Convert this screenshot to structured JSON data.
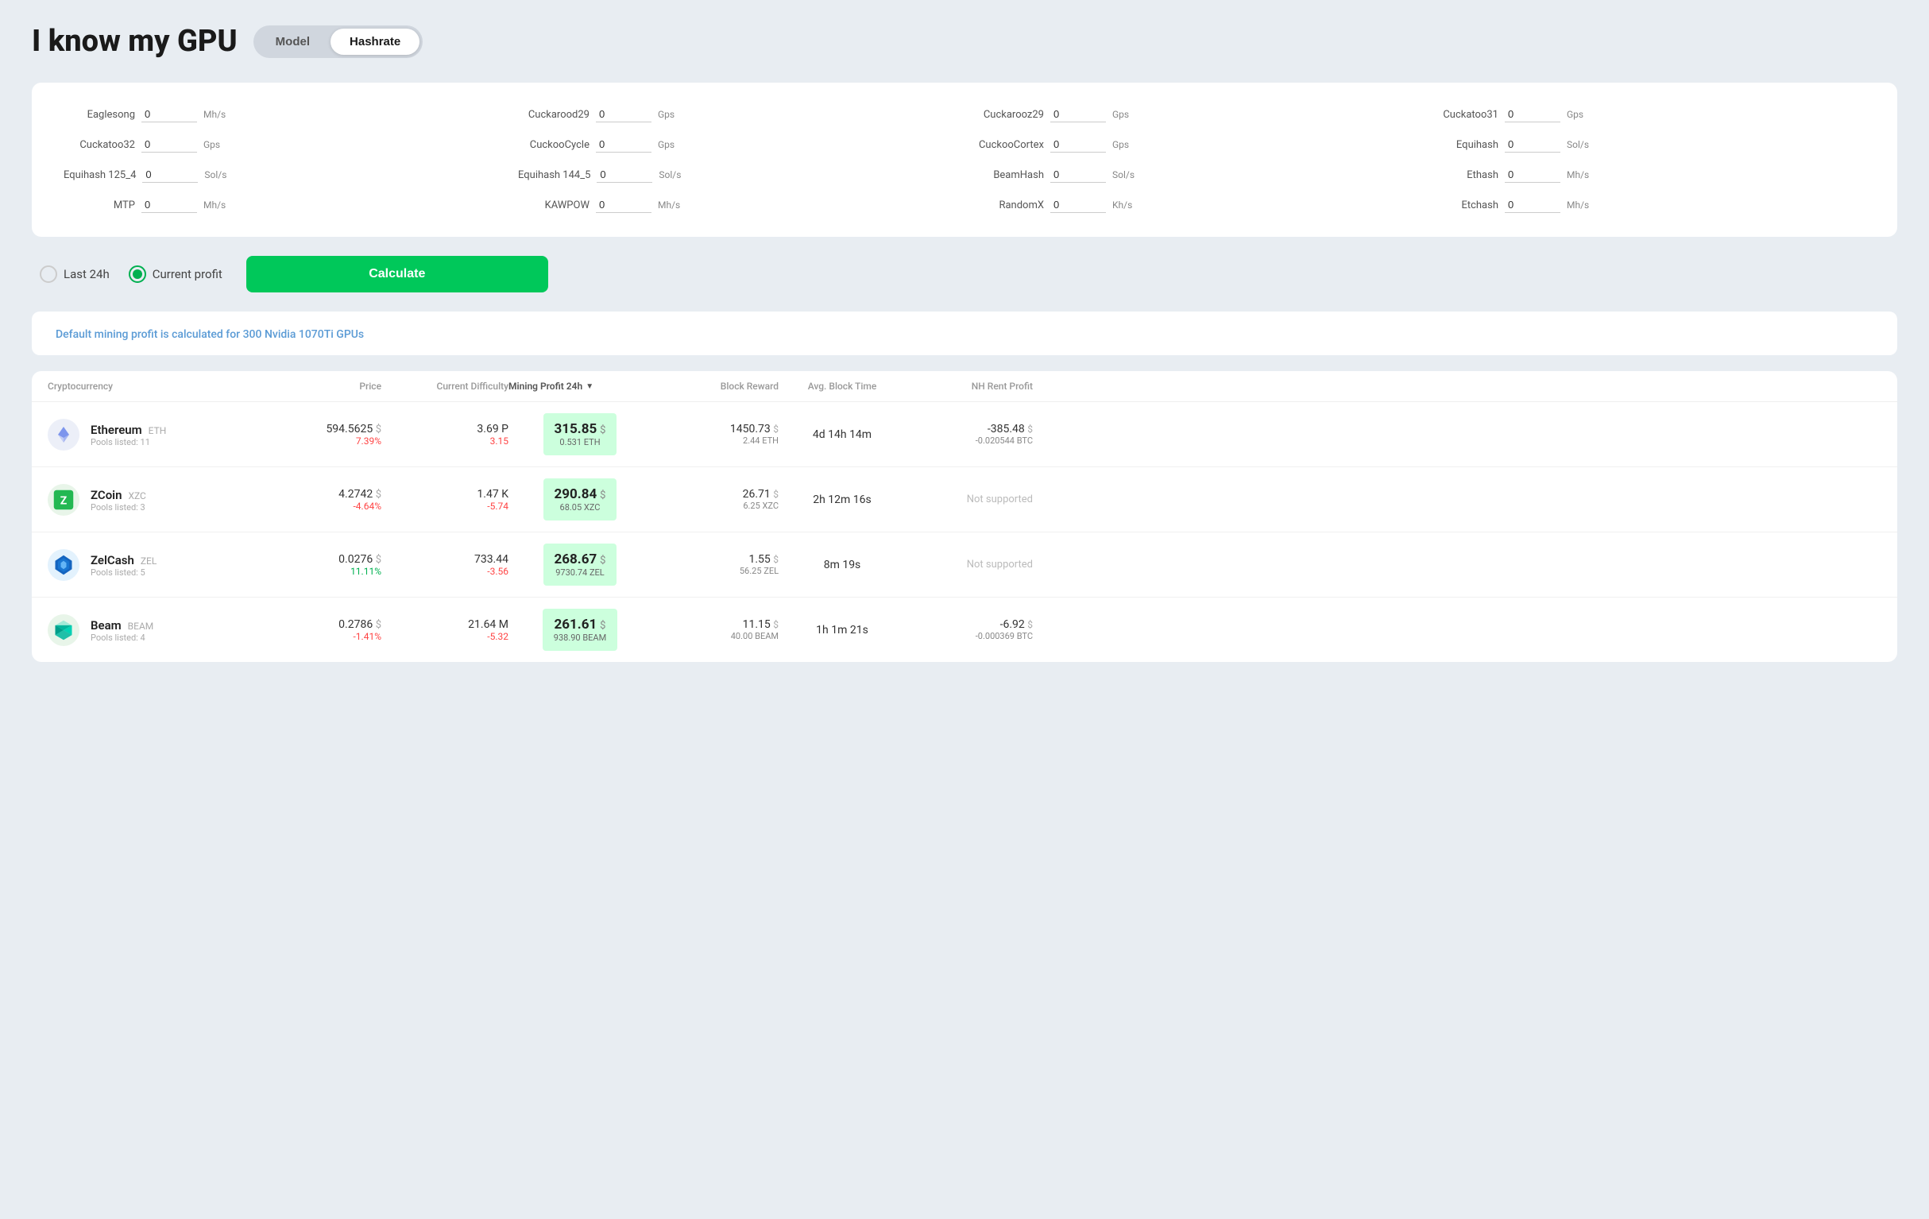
{
  "header": {
    "title": "I know my GPU",
    "toggle": {
      "model_label": "Model",
      "hashrate_label": "Hashrate",
      "active": "Hashrate"
    }
  },
  "hashrate_inputs": [
    {
      "label": "Eaglesong",
      "value": "0",
      "unit": "Mh/s"
    },
    {
      "label": "Cuckarood29",
      "value": "0",
      "unit": "Gps"
    },
    {
      "label": "Cuckarooz29",
      "value": "0",
      "unit": "Gps"
    },
    {
      "label": "Cuckatoo31",
      "value": "0",
      "unit": "Gps"
    },
    {
      "label": "Cuckatoo32",
      "value": "0",
      "unit": "Gps"
    },
    {
      "label": "CuckooCycle",
      "value": "0",
      "unit": "Gps"
    },
    {
      "label": "CuckooCortex",
      "value": "0",
      "unit": "Gps"
    },
    {
      "label": "Equihash",
      "value": "0",
      "unit": "Sol/s"
    },
    {
      "label": "Equihash 125_4",
      "value": "0",
      "unit": "Sol/s"
    },
    {
      "label": "Equihash 144_5",
      "value": "0",
      "unit": "Sol/s"
    },
    {
      "label": "BeamHash",
      "value": "0",
      "unit": "Sol/s"
    },
    {
      "label": "Ethash",
      "value": "0",
      "unit": "Mh/s"
    },
    {
      "label": "MTP",
      "value": "0",
      "unit": "Mh/s"
    },
    {
      "label": "KAWPOW",
      "value": "0",
      "unit": "Mh/s"
    },
    {
      "label": "RandomX",
      "value": "0",
      "unit": "Kh/s"
    },
    {
      "label": "Etchash",
      "value": "0",
      "unit": "Mh/s"
    }
  ],
  "controls": {
    "last24h_label": "Last 24h",
    "current_profit_label": "Current profit",
    "selected": "current_profit",
    "calculate_label": "Calculate"
  },
  "info_banner": {
    "text": "Default mining profit is calculated for 300 Nvidia 1070Ti GPUs"
  },
  "table": {
    "headers": {
      "cryptocurrency": "Cryptocurrency",
      "price": "Price",
      "current_difficulty": "Current Difficulty",
      "mining_profit": "Mining Profit 24h",
      "block_reward": "Block Reward",
      "avg_block_time": "Avg. Block Time",
      "nh_rent_profit": "NH Rent Profit"
    },
    "rows": [
      {
        "coin": "Ethereum",
        "ticker": "ETH",
        "pools": "11",
        "icon_type": "eth",
        "price": "594.5625",
        "price_currency": "$",
        "price_change": "7.39%",
        "price_change_direction": "positive",
        "difficulty": "3.69 P",
        "difficulty_change": "3.15",
        "difficulty_change_direction": "negative",
        "profit_main": "315.85",
        "profit_currency": "$",
        "profit_sub": "0.531 ETH",
        "block_reward_main": "1450.73",
        "block_reward_currency": "$",
        "block_reward_sub": "2.44 ETH",
        "avg_block_time": "4d 14h 14m",
        "nh_main": "-385.48",
        "nh_currency": "$",
        "nh_sub": "-0.020544 BTC"
      },
      {
        "coin": "ZCoin",
        "ticker": "XZC",
        "pools": "3",
        "icon_type": "zcoin",
        "price": "4.2742",
        "price_currency": "$",
        "price_change": "-4.64%",
        "price_change_direction": "negative",
        "difficulty": "1.47 K",
        "difficulty_change": "-5.74",
        "difficulty_change_direction": "negative",
        "profit_main": "290.84",
        "profit_currency": "$",
        "profit_sub": "68.05 XZC",
        "block_reward_main": "26.71",
        "block_reward_currency": "$",
        "block_reward_sub": "6.25 XZC",
        "avg_block_time": "2h 12m 16s",
        "nh_main": null,
        "nh_currency": null,
        "nh_sub": null,
        "nh_not_supported": "Not supported"
      },
      {
        "coin": "ZelCash",
        "ticker": "ZEL",
        "pools": "5",
        "icon_type": "zelcash",
        "price": "0.0276",
        "price_currency": "$",
        "price_change": "11.11%",
        "price_change_direction": "pos-green",
        "difficulty": "733.44",
        "difficulty_change": "-3.56",
        "difficulty_change_direction": "negative",
        "profit_main": "268.67",
        "profit_currency": "$",
        "profit_sub": "9730.74 ZEL",
        "block_reward_main": "1.55",
        "block_reward_currency": "$",
        "block_reward_sub": "56.25 ZEL",
        "avg_block_time": "8m 19s",
        "nh_main": null,
        "nh_currency": null,
        "nh_sub": null,
        "nh_not_supported": "Not supported"
      },
      {
        "coin": "Beam",
        "ticker": "BEAM",
        "pools": "4",
        "icon_type": "beam",
        "price": "0.2786",
        "price_currency": "$",
        "price_change": "-1.41%",
        "price_change_direction": "negative",
        "difficulty": "21.64 M",
        "difficulty_change": "-5.32",
        "difficulty_change_direction": "negative",
        "profit_main": "261.61",
        "profit_currency": "$",
        "profit_sub": "938.90 BEAM",
        "block_reward_main": "11.15",
        "block_reward_currency": "$",
        "block_reward_sub": "40.00 BEAM",
        "avg_block_time": "1h 1m 21s",
        "nh_main": "-6.92",
        "nh_currency": "$",
        "nh_sub": "-0.000369 BTC"
      }
    ]
  }
}
